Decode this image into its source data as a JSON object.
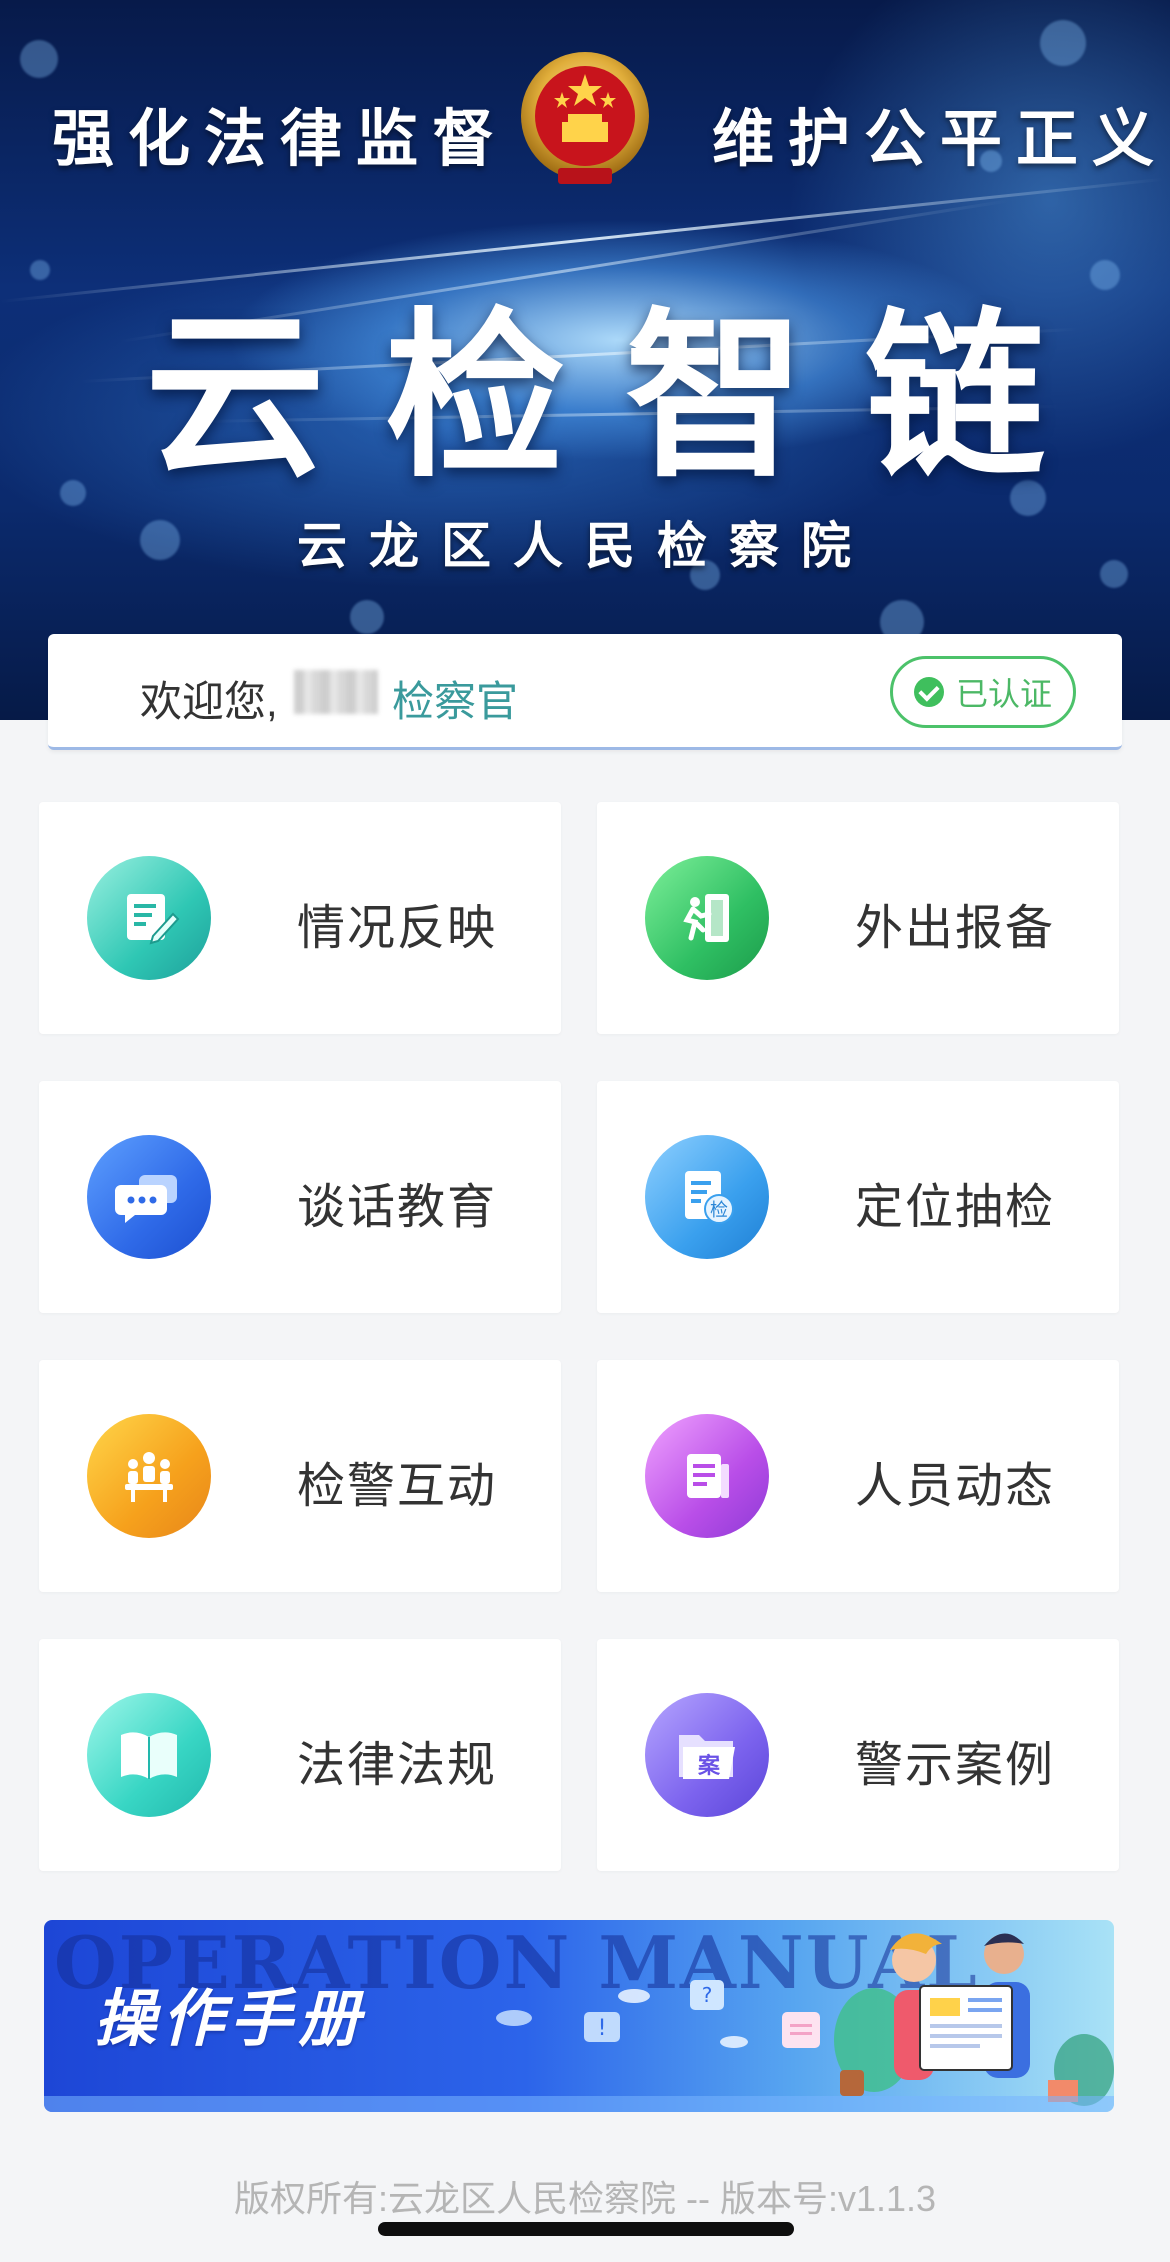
{
  "header": {
    "slogan_left": "强化法律监督",
    "slogan_right": "维护公平正义",
    "app_title_chars": [
      "云",
      "检",
      "智",
      "链"
    ],
    "organization": "云龙区人民检察院"
  },
  "welcome": {
    "greeting": "欢迎您,",
    "role": "检察官",
    "badge_label": "已认证"
  },
  "menu": [
    {
      "label": "情况反映",
      "icon": "edit-note-icon"
    },
    {
      "label": "外出报备",
      "icon": "exit-door-icon"
    },
    {
      "label": "谈话教育",
      "icon": "chat-bubbles-icon"
    },
    {
      "label": "定位抽检",
      "icon": "inspection-doc-icon"
    },
    {
      "label": "检警互动",
      "icon": "meeting-people-icon"
    },
    {
      "label": "人员动态",
      "icon": "document-stack-icon"
    },
    {
      "label": "法律法规",
      "icon": "open-book-icon"
    },
    {
      "label": "警示案例",
      "icon": "case-folder-icon"
    }
  ],
  "manual_banner": {
    "title": "操作手册",
    "background_text": "OPERATION MANUAL",
    "icon_glyph": "案"
  },
  "inspect_glyph": "检",
  "footer": {
    "copyright": "版权所有:云龙区人民检察院 -- 版本号:v1.1.3"
  }
}
